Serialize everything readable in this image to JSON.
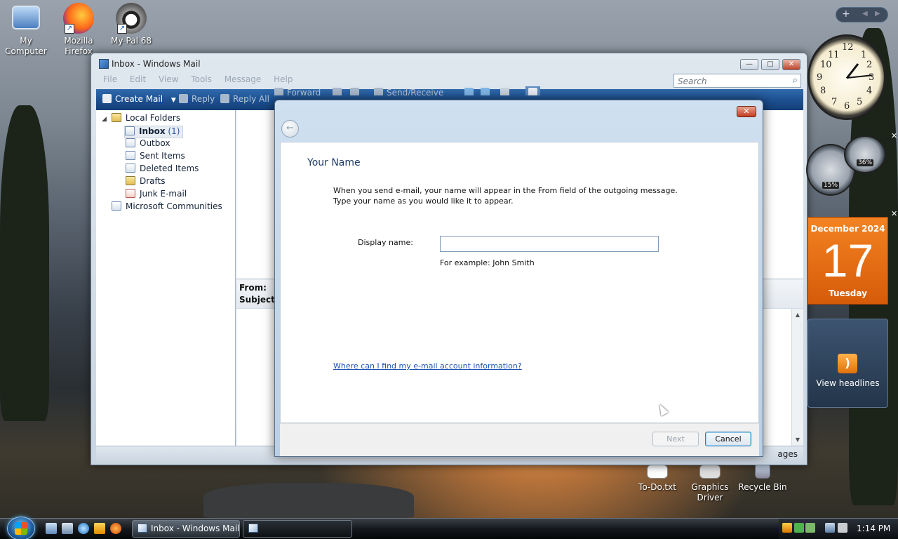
{
  "desktop": {
    "icons": [
      {
        "label": "My Computer",
        "icon": "computer-icon"
      },
      {
        "label": "Mozilla Firefox",
        "icon": "firefox-icon"
      },
      {
        "label": "My-Pal 68",
        "icon": "raccoon-icon"
      },
      {
        "label": "To-Do.txt",
        "icon": "text-file-icon"
      },
      {
        "label": "Graphics Driver",
        "icon": "driver-icon"
      },
      {
        "label": "Recycle Bin",
        "icon": "recycle-bin-icon"
      }
    ]
  },
  "mail_window": {
    "title": "Inbox - Windows Mail",
    "menu": [
      "File",
      "Edit",
      "View",
      "Tools",
      "Message",
      "Help"
    ],
    "search_placeholder": "Search",
    "toolbar": {
      "create_mail": "Create Mail",
      "reply": "Reply",
      "reply_all": "Reply All",
      "forward": "Forward",
      "send_receive": "Send/Receive"
    },
    "folders": {
      "root": "Local Folders",
      "items": [
        {
          "label": "Inbox",
          "count": "(1)"
        },
        {
          "label": "Outbox"
        },
        {
          "label": "Sent Items"
        },
        {
          "label": "Deleted Items"
        },
        {
          "label": "Drafts"
        },
        {
          "label": "Junk E-mail"
        }
      ],
      "communities": "Microsoft Communities"
    },
    "preview": {
      "from_label": "From:",
      "subject_label": "Subject:"
    },
    "status_text": "ages"
  },
  "wizard": {
    "heading": "Your Name",
    "description_line1": "When you send e-mail, your name will appear in the From field of the outgoing message.",
    "description_line2": "Type your name as you would like it to appear.",
    "display_name_label": "Display name:",
    "display_name_value": "",
    "example": "For example: John Smith",
    "help_link": "Where can I find my e-mail account information?",
    "next_button": "Next",
    "cancel_button": "Cancel"
  },
  "gadgets": {
    "calendar": {
      "month": "December 2024",
      "day": "17",
      "weekday": "Tuesday"
    },
    "meters": {
      "cpu": "15%",
      "memory": "36%"
    },
    "feeds": {
      "label": "View headlines"
    }
  },
  "taskbar": {
    "active_task": "Inbox - Windows Mail",
    "time": "1:14 PM"
  }
}
